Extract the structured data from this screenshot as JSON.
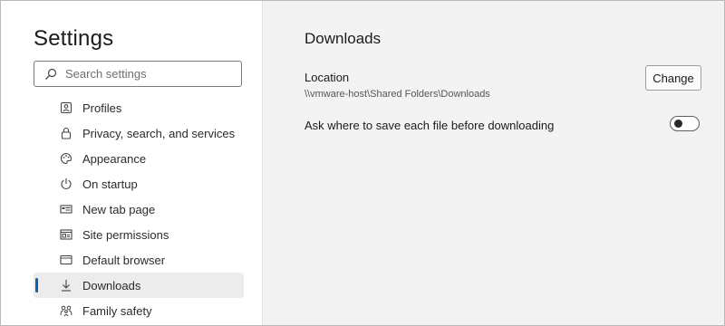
{
  "sidebar": {
    "title": "Settings",
    "search_placeholder": "Search settings",
    "items": [
      {
        "label": "Profiles",
        "icon": "profile-icon"
      },
      {
        "label": "Privacy, search, and services",
        "icon": "lock-icon"
      },
      {
        "label": "Appearance",
        "icon": "palette-icon"
      },
      {
        "label": "On startup",
        "icon": "power-icon"
      },
      {
        "label": "New tab page",
        "icon": "new-tab-icon"
      },
      {
        "label": "Site permissions",
        "icon": "site-permissions-icon"
      },
      {
        "label": "Default browser",
        "icon": "browser-icon"
      },
      {
        "label": "Downloads",
        "icon": "download-icon",
        "active": true
      },
      {
        "label": "Family safety",
        "icon": "family-icon"
      }
    ]
  },
  "main": {
    "title": "Downloads",
    "location_label": "Location",
    "location_path": "\\\\vmware-host\\Shared Folders\\Downloads",
    "change_label": "Change",
    "ask_label": "Ask where to save each file before downloading",
    "ask_enabled": false
  },
  "colors": {
    "accent": "#0f5fb5",
    "main_bg": "#f3f3f3",
    "active_item_bg": "#ececec"
  }
}
